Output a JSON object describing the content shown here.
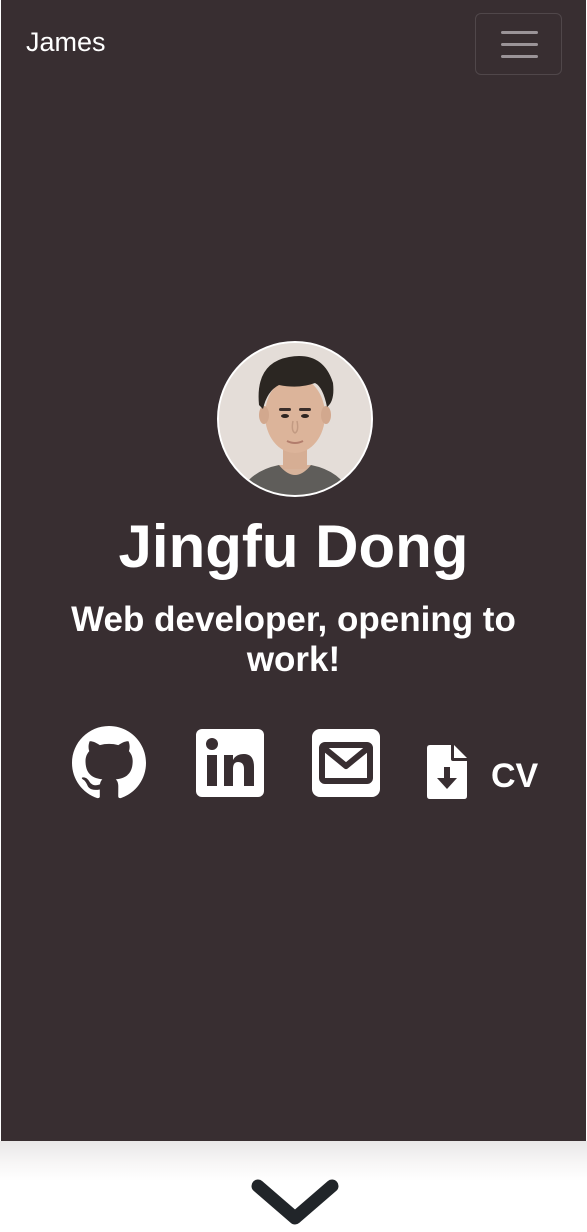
{
  "navbar": {
    "brand": "James",
    "menu_icon": "hamburger-menu-icon"
  },
  "hero": {
    "background": "#382e31",
    "name": "Jingfu Dong",
    "tagline": "Web developer, opening to work!",
    "avatar_alt": "profile photo"
  },
  "social": {
    "github_icon": "github-icon",
    "linkedin_icon": "linkedin-icon",
    "email_icon": "envelope-icon",
    "cv_icon": "file-download-icon",
    "cv_label": "CV"
  },
  "scroll": {
    "icon": "chevron-down-icon",
    "color": "#212529"
  }
}
